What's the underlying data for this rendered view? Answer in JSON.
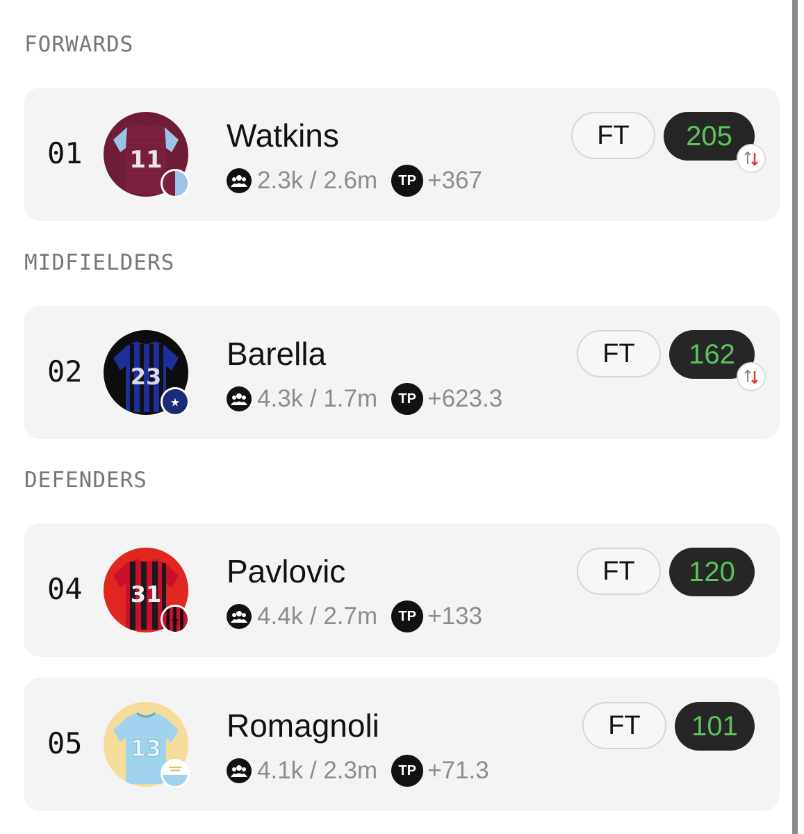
{
  "sections": {
    "forwards": "FORWARDS",
    "midfielders": "MIDFIELDERS",
    "defenders": "DEFENDERS"
  },
  "players": [
    {
      "number": "01",
      "name": "Watkins",
      "kit_number": "11",
      "stats": "2.3k / 2.6m",
      "tp_label": "TP",
      "tp_value": "+367",
      "ft_label": "FT",
      "score": "205",
      "has_swap": true,
      "kit_colors": {
        "body": "#7a1f3d",
        "sleeves": "#9cc3e4",
        "bg": "#6d1d35"
      }
    },
    {
      "number": "02",
      "name": "Barella",
      "kit_number": "23",
      "stats": "4.3k / 1.7m",
      "tp_label": "TP",
      "tp_value": "+623.3",
      "ft_label": "FT",
      "score": "162",
      "has_swap": true,
      "kit_colors": {
        "body": "#1d2f9a",
        "stripes": "#111111",
        "bg": "#0d0d0d"
      }
    },
    {
      "number": "04",
      "name": "Pavlovic",
      "kit_number": "31",
      "stats": "4.4k / 2.7m",
      "tp_label": "TP",
      "tp_value": "+133",
      "ft_label": "FT",
      "score": "120",
      "has_swap": false,
      "kit_colors": {
        "body": "#c8102e",
        "stripes": "#1a1a1a",
        "bg": "#e0261e"
      }
    },
    {
      "number": "05",
      "name": "Romagnoli",
      "kit_number": "13",
      "stats": "4.1k / 2.3m",
      "tp_label": "TP",
      "tp_value": "+71.3",
      "ft_label": "FT",
      "score": "101",
      "has_swap": false,
      "kit_colors": {
        "body": "#9fd3ee",
        "bg": "#f6dc9a"
      }
    }
  ],
  "colors": {
    "card_bg": "#f4f4f4",
    "score_bg": "#262626",
    "score_text": "#5cc45c",
    "section_text": "#777777",
    "swap_down": "#e0392b"
  },
  "icons": {
    "stats_icon": "users-icon",
    "swap_icon": "swap-arrows-icon"
  }
}
